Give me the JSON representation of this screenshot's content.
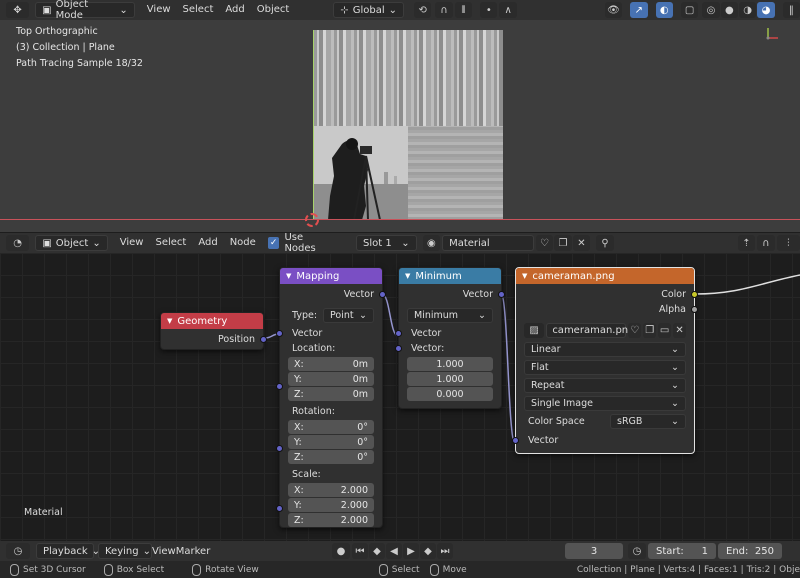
{
  "viewport_header": {
    "mode": "Object Mode",
    "menus": [
      "View",
      "Select",
      "Add",
      "Object"
    ],
    "transform_orientation": "Global"
  },
  "viewport": {
    "view_name": "Top Orthographic",
    "collection": "(3) Collection | Plane",
    "render_status": "Path Tracing Sample 18/32"
  },
  "node_header": {
    "object_type": "Object",
    "menus": [
      "View",
      "Select",
      "Add",
      "Node"
    ],
    "use_nodes_label": "Use Nodes",
    "use_nodes_checked": true,
    "slot": "Slot 1",
    "material": "Material"
  },
  "nodes": {
    "geometry": {
      "title": "Geometry",
      "output": "Position",
      "color": "#c33d47"
    },
    "mapping": {
      "title": "Mapping",
      "color": "#7a4fc4",
      "output": "Vector",
      "type_label": "Type:",
      "type_value": "Point",
      "input": "Vector",
      "location_label": "Location:",
      "location": [
        {
          "axis": "X:",
          "value": "0m"
        },
        {
          "axis": "Y:",
          "value": "0m"
        },
        {
          "axis": "Z:",
          "value": "0m"
        }
      ],
      "rotation_label": "Rotation:",
      "rotation": [
        {
          "axis": "X:",
          "value": "0°"
        },
        {
          "axis": "Y:",
          "value": "0°"
        },
        {
          "axis": "Z:",
          "value": "0°"
        }
      ],
      "scale_label": "Scale:",
      "scale": [
        {
          "axis": "X:",
          "value": "2.000"
        },
        {
          "axis": "Y:",
          "value": "2.000"
        },
        {
          "axis": "Z:",
          "value": "2.000"
        }
      ]
    },
    "minimum": {
      "title": "Minimum",
      "color": "#3a7ca5",
      "output": "Vector",
      "operation": "Minimum",
      "input1": "Vector",
      "input2_label": "Vector:",
      "values": [
        "1.000",
        "1.000",
        "0.000"
      ]
    },
    "image": {
      "title": "cameraman.png",
      "color": "#c4662b",
      "outputs": [
        "Color",
        "Alpha"
      ],
      "image_name": "cameraman.png",
      "interpolation": "Linear",
      "projection": "Flat",
      "extension": "Repeat",
      "source": "Single Image",
      "color_space_label": "Color Space",
      "color_space": "sRGB",
      "input": "Vector"
    }
  },
  "editor_label": "Material",
  "timeline": {
    "menus": [
      "Playback",
      "Keying",
      "View",
      "Marker"
    ],
    "current_frame": "3",
    "start_label": "Start:",
    "start": "1",
    "end_label": "End:",
    "end": "250"
  },
  "statusbar": {
    "items": [
      "Set 3D Cursor",
      "Box Select",
      "Rotate View",
      "Select",
      "Move"
    ],
    "info": "Collection | Plane | Verts:4 | Faces:1 | Tris:2 | Obje"
  }
}
